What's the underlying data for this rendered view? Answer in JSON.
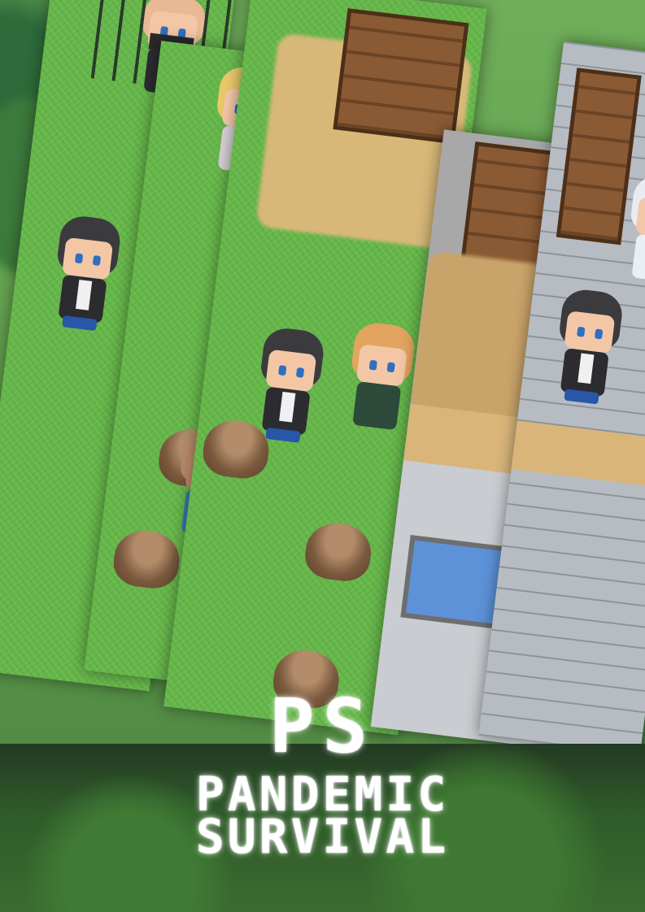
{
  "game": {
    "logo": "PS",
    "title_line1": "PANDEMIC",
    "title_line2": "SURVIVAL"
  },
  "colors": {
    "grass": "#66b84a",
    "title_text": "#ffffff",
    "band": "#2f5a2a",
    "hero_hair": "#3b3b3d",
    "hero_eyes": "#2f6fc0"
  },
  "screens": [
    {
      "scene": "grass-field-fence"
    },
    {
      "scene": "grass-with-npcs"
    },
    {
      "scene": "village-square-stumps"
    },
    {
      "scene": "building-front"
    },
    {
      "scene": "stone-house-interior"
    }
  ]
}
